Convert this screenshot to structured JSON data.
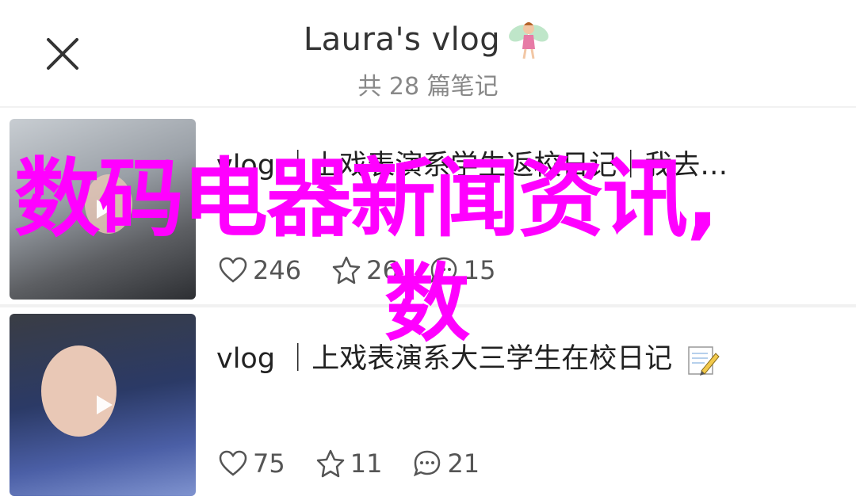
{
  "header": {
    "close_icon": "close-icon",
    "title": "Laura's vlog",
    "title_emoji": "fairy-emoji",
    "subtitle": "共 28 篇笔记"
  },
  "posts": [
    {
      "title": "vlog ｜上戏表演系学生返校日记｜我去…",
      "likes": "246",
      "collects": "26",
      "comments": "15",
      "has_video": true
    },
    {
      "title": "vlog ｜上戏表演系大三学生在校日记",
      "title_emoji": "pencil-memo-emoji",
      "likes": "75",
      "collects": "11",
      "comments": "21",
      "has_video": true
    }
  ],
  "watermark": {
    "line1": "数码电器新闻资讯,",
    "line2": "数",
    "color": "#ff00ff"
  }
}
